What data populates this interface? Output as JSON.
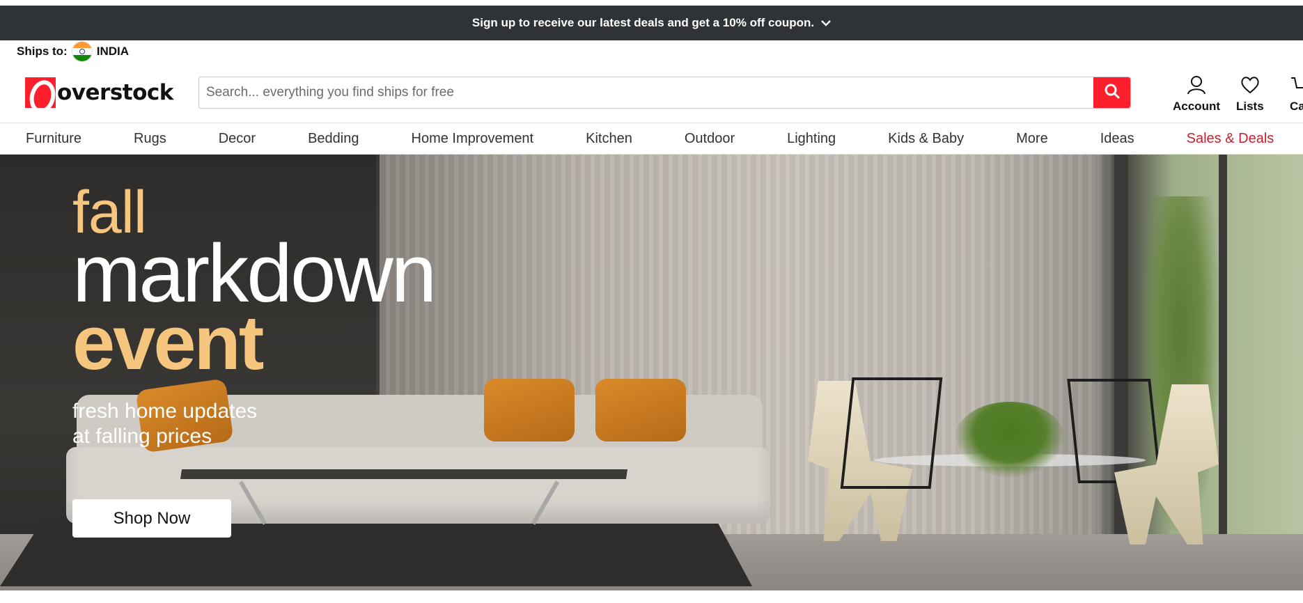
{
  "promo": {
    "text": "Sign up to receive our latest deals and get a 10% off coupon.",
    "icon": "chevron-down-icon"
  },
  "ships": {
    "label": "Ships to:",
    "country": "INDIA"
  },
  "logo": {
    "text": "overstock"
  },
  "search": {
    "placeholder": "Search... everything you find ships for free",
    "value": ""
  },
  "account": {
    "label": "Account"
  },
  "lists": {
    "label": "Lists"
  },
  "cart": {
    "label": "Ca"
  },
  "nav": {
    "items": [
      {
        "label": "Furniture"
      },
      {
        "label": "Rugs"
      },
      {
        "label": "Decor"
      },
      {
        "label": "Bedding"
      },
      {
        "label": "Home Improvement"
      },
      {
        "label": "Kitchen"
      },
      {
        "label": "Outdoor"
      },
      {
        "label": "Lighting"
      },
      {
        "label": "Kids & Baby"
      },
      {
        "label": "More"
      },
      {
        "label": "Ideas"
      },
      {
        "label": "Sales & Deals"
      }
    ]
  },
  "hero": {
    "line1": "fall",
    "line2": "markdown",
    "line3": "event",
    "sub1": "fresh home updates",
    "sub2": "at falling prices",
    "cta": "Shop Now"
  },
  "colors": {
    "brand": "#ff1f2c",
    "promo_bg": "#2f3337",
    "sale": "#c7202f",
    "hero_accent": "#f6c57e"
  }
}
